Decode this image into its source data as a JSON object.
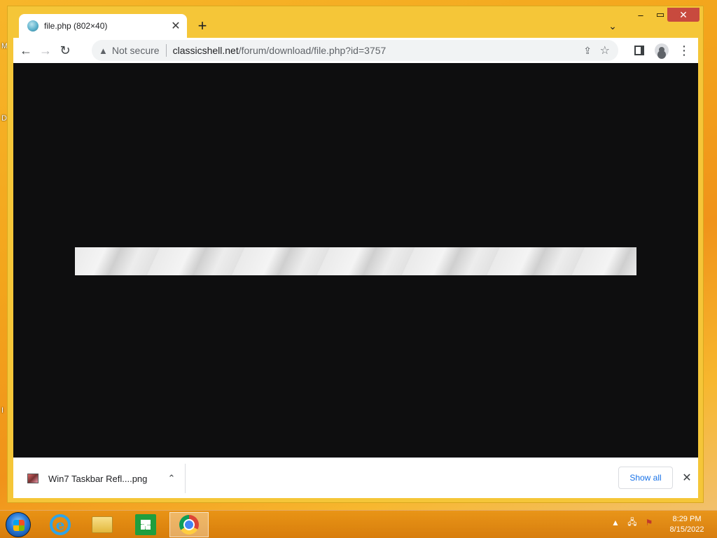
{
  "desktop": {
    "edge_letters": [
      "M",
      "D",
      "I"
    ]
  },
  "window": {
    "tab_title": "file.php (802×40)",
    "tab_close_glyph": "✕",
    "new_tab_glyph": "+",
    "tab_search_glyph": "⌄",
    "minimize_glyph": "–",
    "maximize_glyph": "▭",
    "close_glyph": "✕"
  },
  "toolbar": {
    "back_glyph": "←",
    "forward_glyph": "→",
    "reload_glyph": "↻",
    "warning_glyph": "▲",
    "security_label": "Not secure",
    "url_host": "classicshell.net",
    "url_path": "/forum/download/file.php?id=3757",
    "share_glyph": "⇪",
    "bookmark_glyph": "☆",
    "menu_glyph": "⋮"
  },
  "downloads": {
    "file_name": "Win7 Taskbar Refl....png",
    "caret_glyph": "⌃",
    "show_all_label": "Show all",
    "close_glyph": "✕"
  },
  "taskbar": {
    "ie_glyph": "e",
    "tray_up_glyph": "▲",
    "tray_network_glyph": "🖧",
    "tray_flag_glyph": "⚑",
    "time": "8:29 PM",
    "date": "8/15/2022"
  }
}
